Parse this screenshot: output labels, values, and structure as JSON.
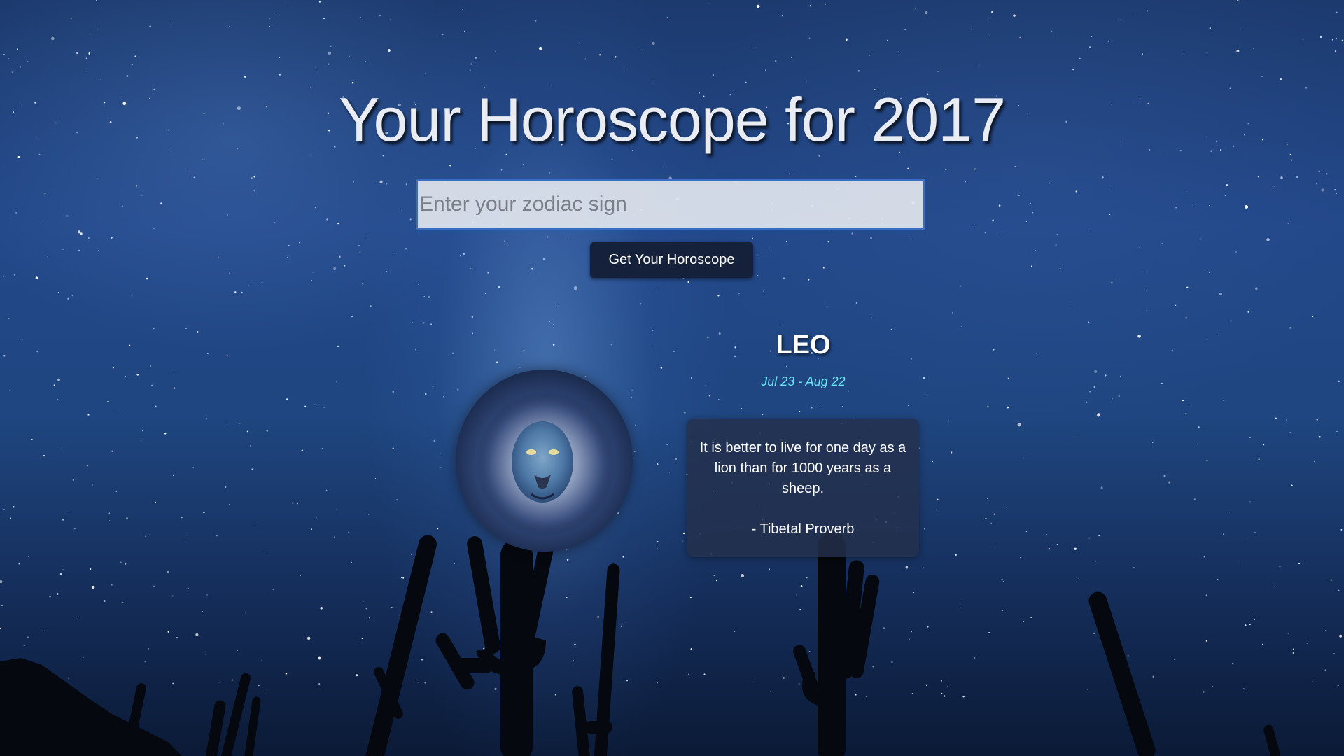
{
  "page": {
    "title": "Your Horoscope for 2017"
  },
  "search": {
    "placeholder": "Enter your zodiac sign",
    "value": "",
    "button_label": "Get Your Horoscope"
  },
  "result": {
    "sign": "LEO",
    "dates": "Jul 23 - Aug 22",
    "image_icon": "lion-icon",
    "quote": "It is better to live for one day as a lion than for 1000 years as a sheep.",
    "author": "- Tibetal Proverb"
  },
  "colors": {
    "title": "#e9ecf2",
    "button_bg": "#15213a",
    "dates": "#6fe4f7",
    "card_bg": "#24304c"
  }
}
